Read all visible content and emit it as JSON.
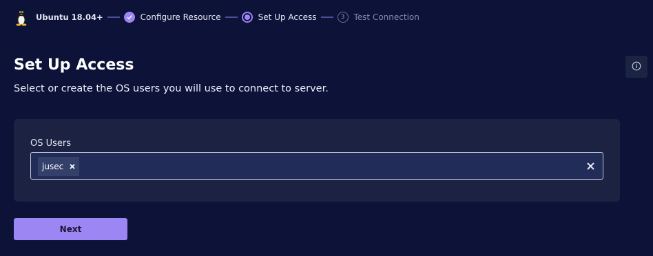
{
  "stepper": {
    "os_icon": "tux-penguin-icon",
    "os_name": "Ubuntu 18.04+",
    "steps": [
      {
        "label": "Configure Resource",
        "state": "done",
        "icon": "check-icon"
      },
      {
        "label": "Set Up Access",
        "state": "active"
      },
      {
        "label": "Test Connection",
        "state": "pending",
        "number": "3"
      }
    ]
  },
  "info_button": {
    "icon": "info-icon"
  },
  "page": {
    "title": "Set Up Access",
    "subtitle": "Select or create the OS users you will use to connect to server."
  },
  "os_users": {
    "label": "OS Users",
    "selected": [
      "jusec"
    ],
    "chip_remove_icon": "close-icon",
    "clear_icon": "close-icon"
  },
  "next_button": {
    "label": "Next"
  },
  "colors": {
    "background": "#0c1238",
    "card": "#1c2242",
    "accent": "#9b86f4",
    "input_bg": "#222c58"
  }
}
